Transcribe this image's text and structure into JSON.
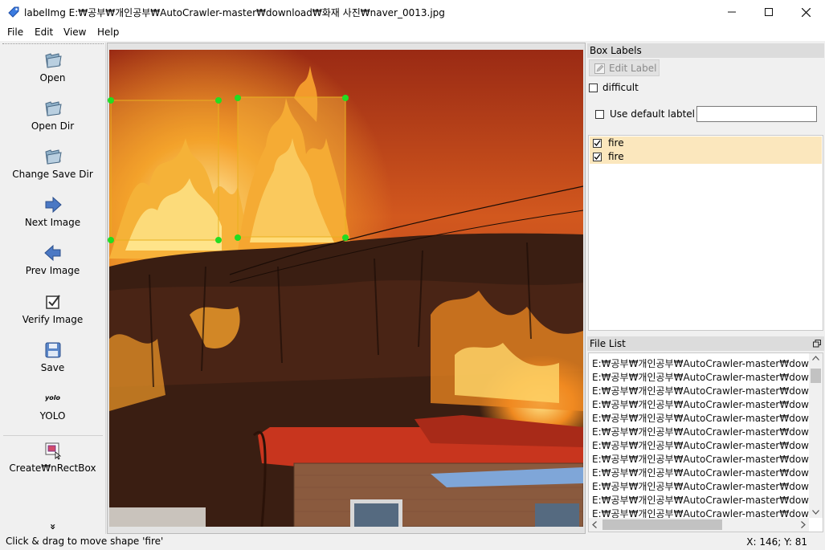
{
  "window": {
    "title": "labelImg E:₩공부₩개인공부₩AutoCrawler-master₩download₩화재 사진₩naver_0013.jpg",
    "controls": {
      "minimize": "—",
      "maximize": "☐",
      "close": "✕"
    }
  },
  "menu": [
    "File",
    "Edit",
    "View",
    "Help"
  ],
  "toolbar": {
    "open": "Open",
    "open_dir": "Open Dir",
    "change_save_dir": "Change Save Dir",
    "next_image": "Next Image",
    "prev_image": "Prev Image",
    "verify_image": "Verify Image",
    "save": "Save",
    "yolo_icon_text": "yolo",
    "yolo": "YOLO",
    "create_rect_box": "Create₩nRectBox",
    "more": "»"
  },
  "box_labels": {
    "title": "Box Labels",
    "edit_label": "Edit Label",
    "difficult": "difficult",
    "difficult_checked": false,
    "use_default_label": "Use default labtel",
    "use_default_checked": false,
    "default_label_value": "",
    "labels": [
      {
        "text": "fire",
        "checked": true
      },
      {
        "text": "fire",
        "checked": true
      }
    ]
  },
  "file_list": {
    "title": "File List",
    "items": [
      "E:₩공부₩개인공부₩AutoCrawler-master₩downloa",
      "E:₩공부₩개인공부₩AutoCrawler-master₩downloa",
      "E:₩공부₩개인공부₩AutoCrawler-master₩downloa",
      "E:₩공부₩개인공부₩AutoCrawler-master₩downloa",
      "E:₩공부₩개인공부₩AutoCrawler-master₩downloa",
      "E:₩공부₩개인공부₩AutoCrawler-master₩downloa",
      "E:₩공부₩개인공부₩AutoCrawler-master₩downloa",
      "E:₩공부₩개인공부₩AutoCrawler-master₩downloa",
      "E:₩공부₩개인공부₩AutoCrawler-master₩downloa",
      "E:₩공부₩개인공부₩AutoCrawler-master₩downloa",
      "E:₩공부₩개인공부₩AutoCrawler-master₩downloa",
      "E:₩공부₩개인공부₩AutoCrawler-master₩downloa"
    ]
  },
  "status": {
    "message": "Click & drag to move shape 'fire'",
    "coords": "X: 146; Y: 81"
  },
  "colors": {
    "handle": "#22dd22",
    "box_line": "#e8b020",
    "label_highlight": "#fbe7bd"
  }
}
